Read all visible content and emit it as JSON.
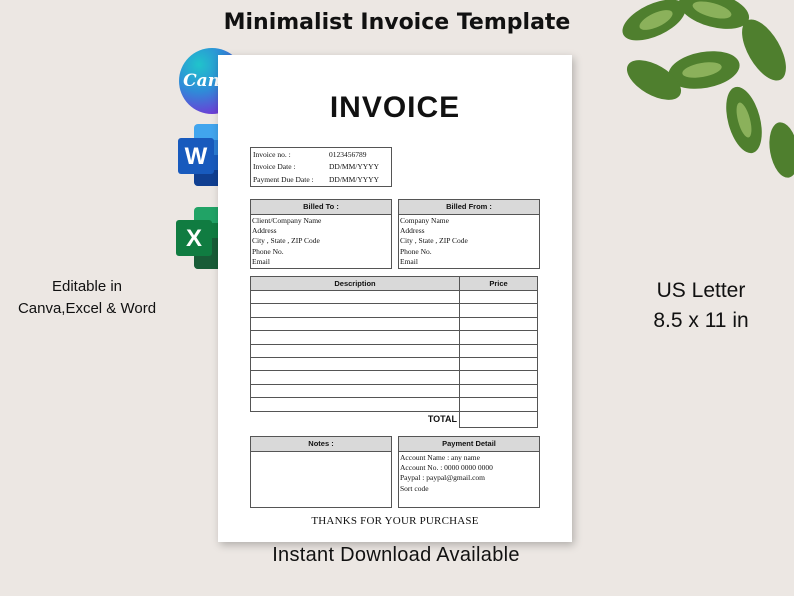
{
  "header": {
    "title": "Minimalist Invoice Template"
  },
  "apps": {
    "canva_label": "Canva",
    "word_letter": "W",
    "excel_letter": "X",
    "colors": {
      "word": "#185abd",
      "excel": "#107c41"
    }
  },
  "captions": {
    "editable_line1": "Editable in",
    "editable_line2": "Canva,Excel & Word",
    "size_line1": "US Letter",
    "size_line2": "8.5 x 11 in",
    "download": "Instant Download Available"
  },
  "invoice": {
    "title": "INVOICE",
    "meta": [
      {
        "label": "Invoice no. :",
        "value": "0123456789"
      },
      {
        "label": "Invoice Date :",
        "value": "DD/MM/YYYY"
      },
      {
        "label": "Payment Due Date :",
        "value": "DD/MM/YYYY"
      }
    ],
    "billed_to": {
      "heading": "Billed To :",
      "lines": [
        "Client/Company Name",
        "Address",
        "City , State , ZIP Code",
        "Phone No.",
        "Email"
      ]
    },
    "billed_from": {
      "heading": "Billed From :",
      "lines": [
        "Company Name",
        "Address",
        "City , State , ZIP Code",
        "Phone No.",
        "Email"
      ]
    },
    "table": {
      "col_description": "Description",
      "col_price": "Price",
      "empty_rows": 9,
      "total_label": "TOTAL"
    },
    "notes": {
      "heading": "Notes :"
    },
    "payment": {
      "heading": "Payment Detail",
      "lines": [
        "Account Name : any name",
        "Account No. : 0000 0000 0000",
        "Paypal : paypal@gmail.com",
        "Sort code"
      ]
    },
    "footer": "THANKS FOR YOUR PURCHASE"
  }
}
